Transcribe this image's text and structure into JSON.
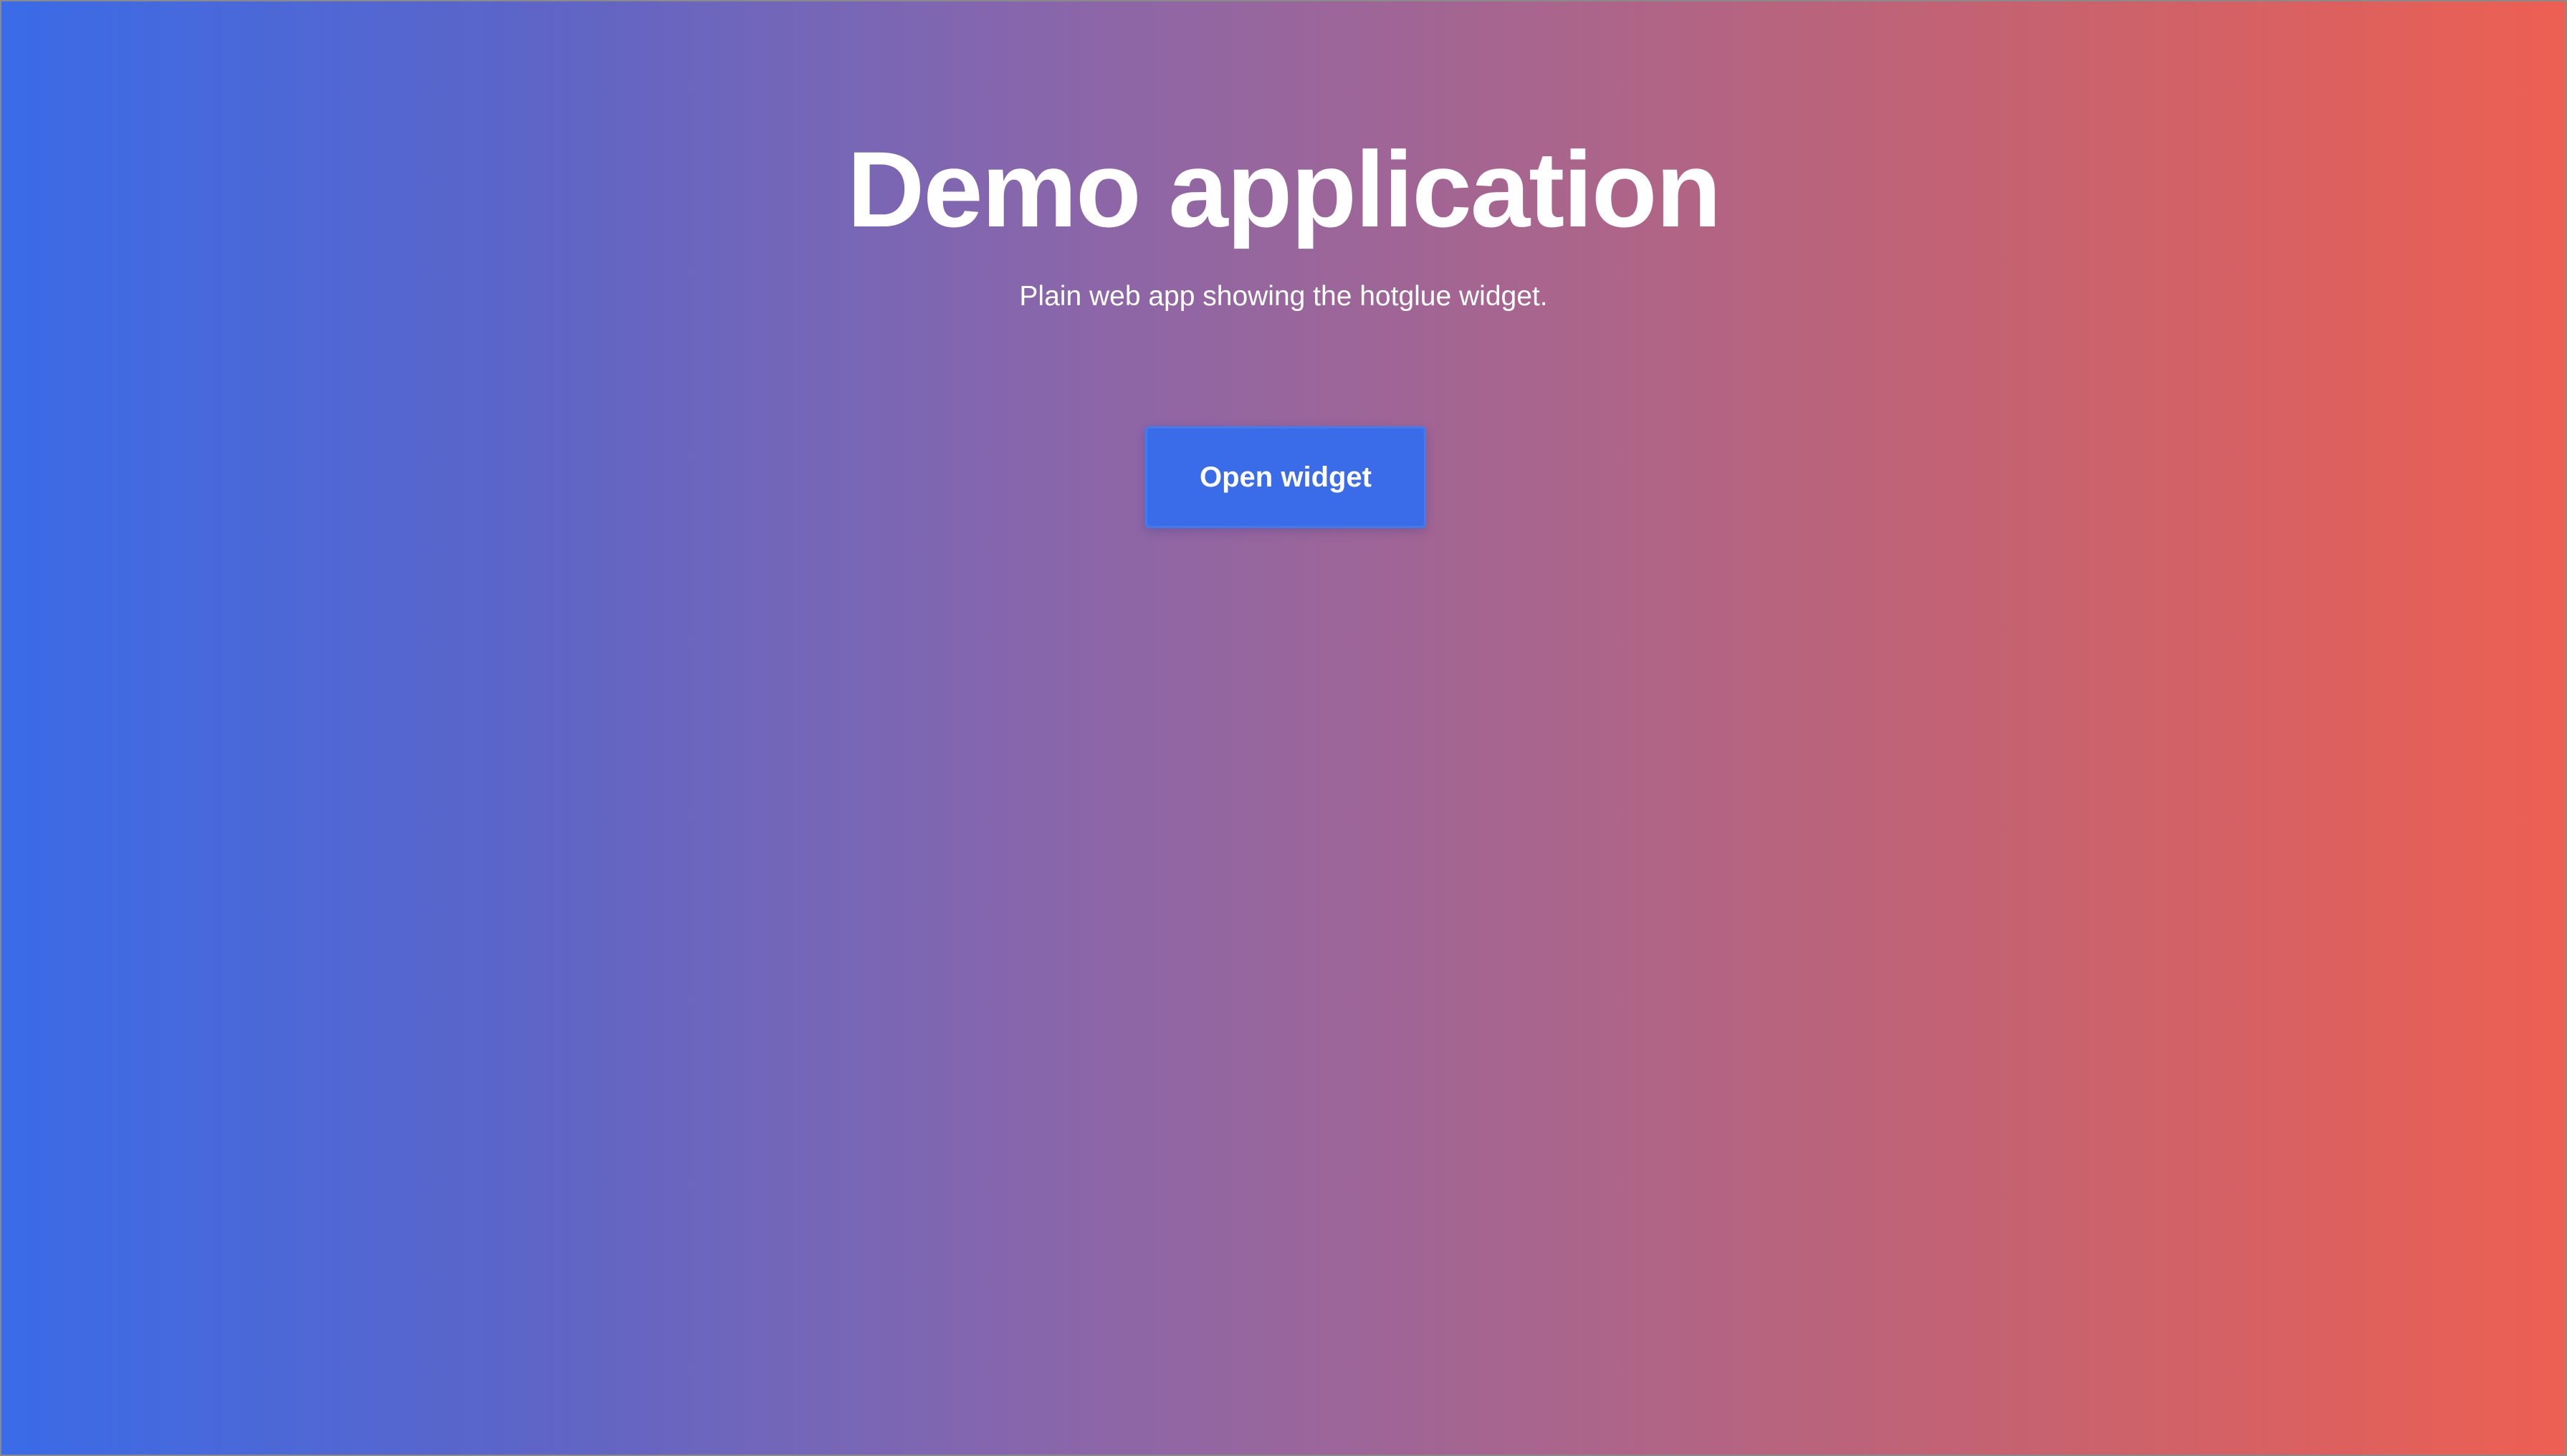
{
  "page": {
    "title": "Demo application",
    "subtitle": "Plain web app showing the hotglue widget.",
    "open_button_label": "Open widget"
  },
  "colors": {
    "gradient_start": "#3a6be8",
    "gradient_end": "#ed5f52",
    "button": "#3a6be8",
    "text": "#ffffff"
  }
}
